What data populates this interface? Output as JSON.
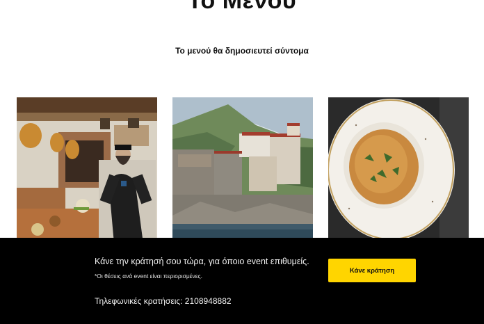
{
  "page": {
    "title": "Το Μενού",
    "subtitle": "Το μενού θα δημοσιευτεί σύντομα"
  },
  "gallery": {
    "images": [
      {
        "id": "chef-kitchen",
        "subject": "chef in monastery kitchen"
      },
      {
        "id": "monastery-cliff",
        "subject": "monastery on cliff by the sea"
      },
      {
        "id": "soup-bowl",
        "subject": "bowl of soup with herbs"
      }
    ]
  },
  "booking_bar": {
    "headline": "Κάνε την κράτησή σου τώρα, για όποιο event επιθυμείς.",
    "note": "*Οι θέσεις ανά event είναι περιορισμένες.",
    "phone_text": "Τηλεφωνικές κρατήσεις: 2108948882",
    "button_label": "Κάνε κράτηση",
    "button_color": "#ffd500",
    "background_color": "#000000"
  }
}
